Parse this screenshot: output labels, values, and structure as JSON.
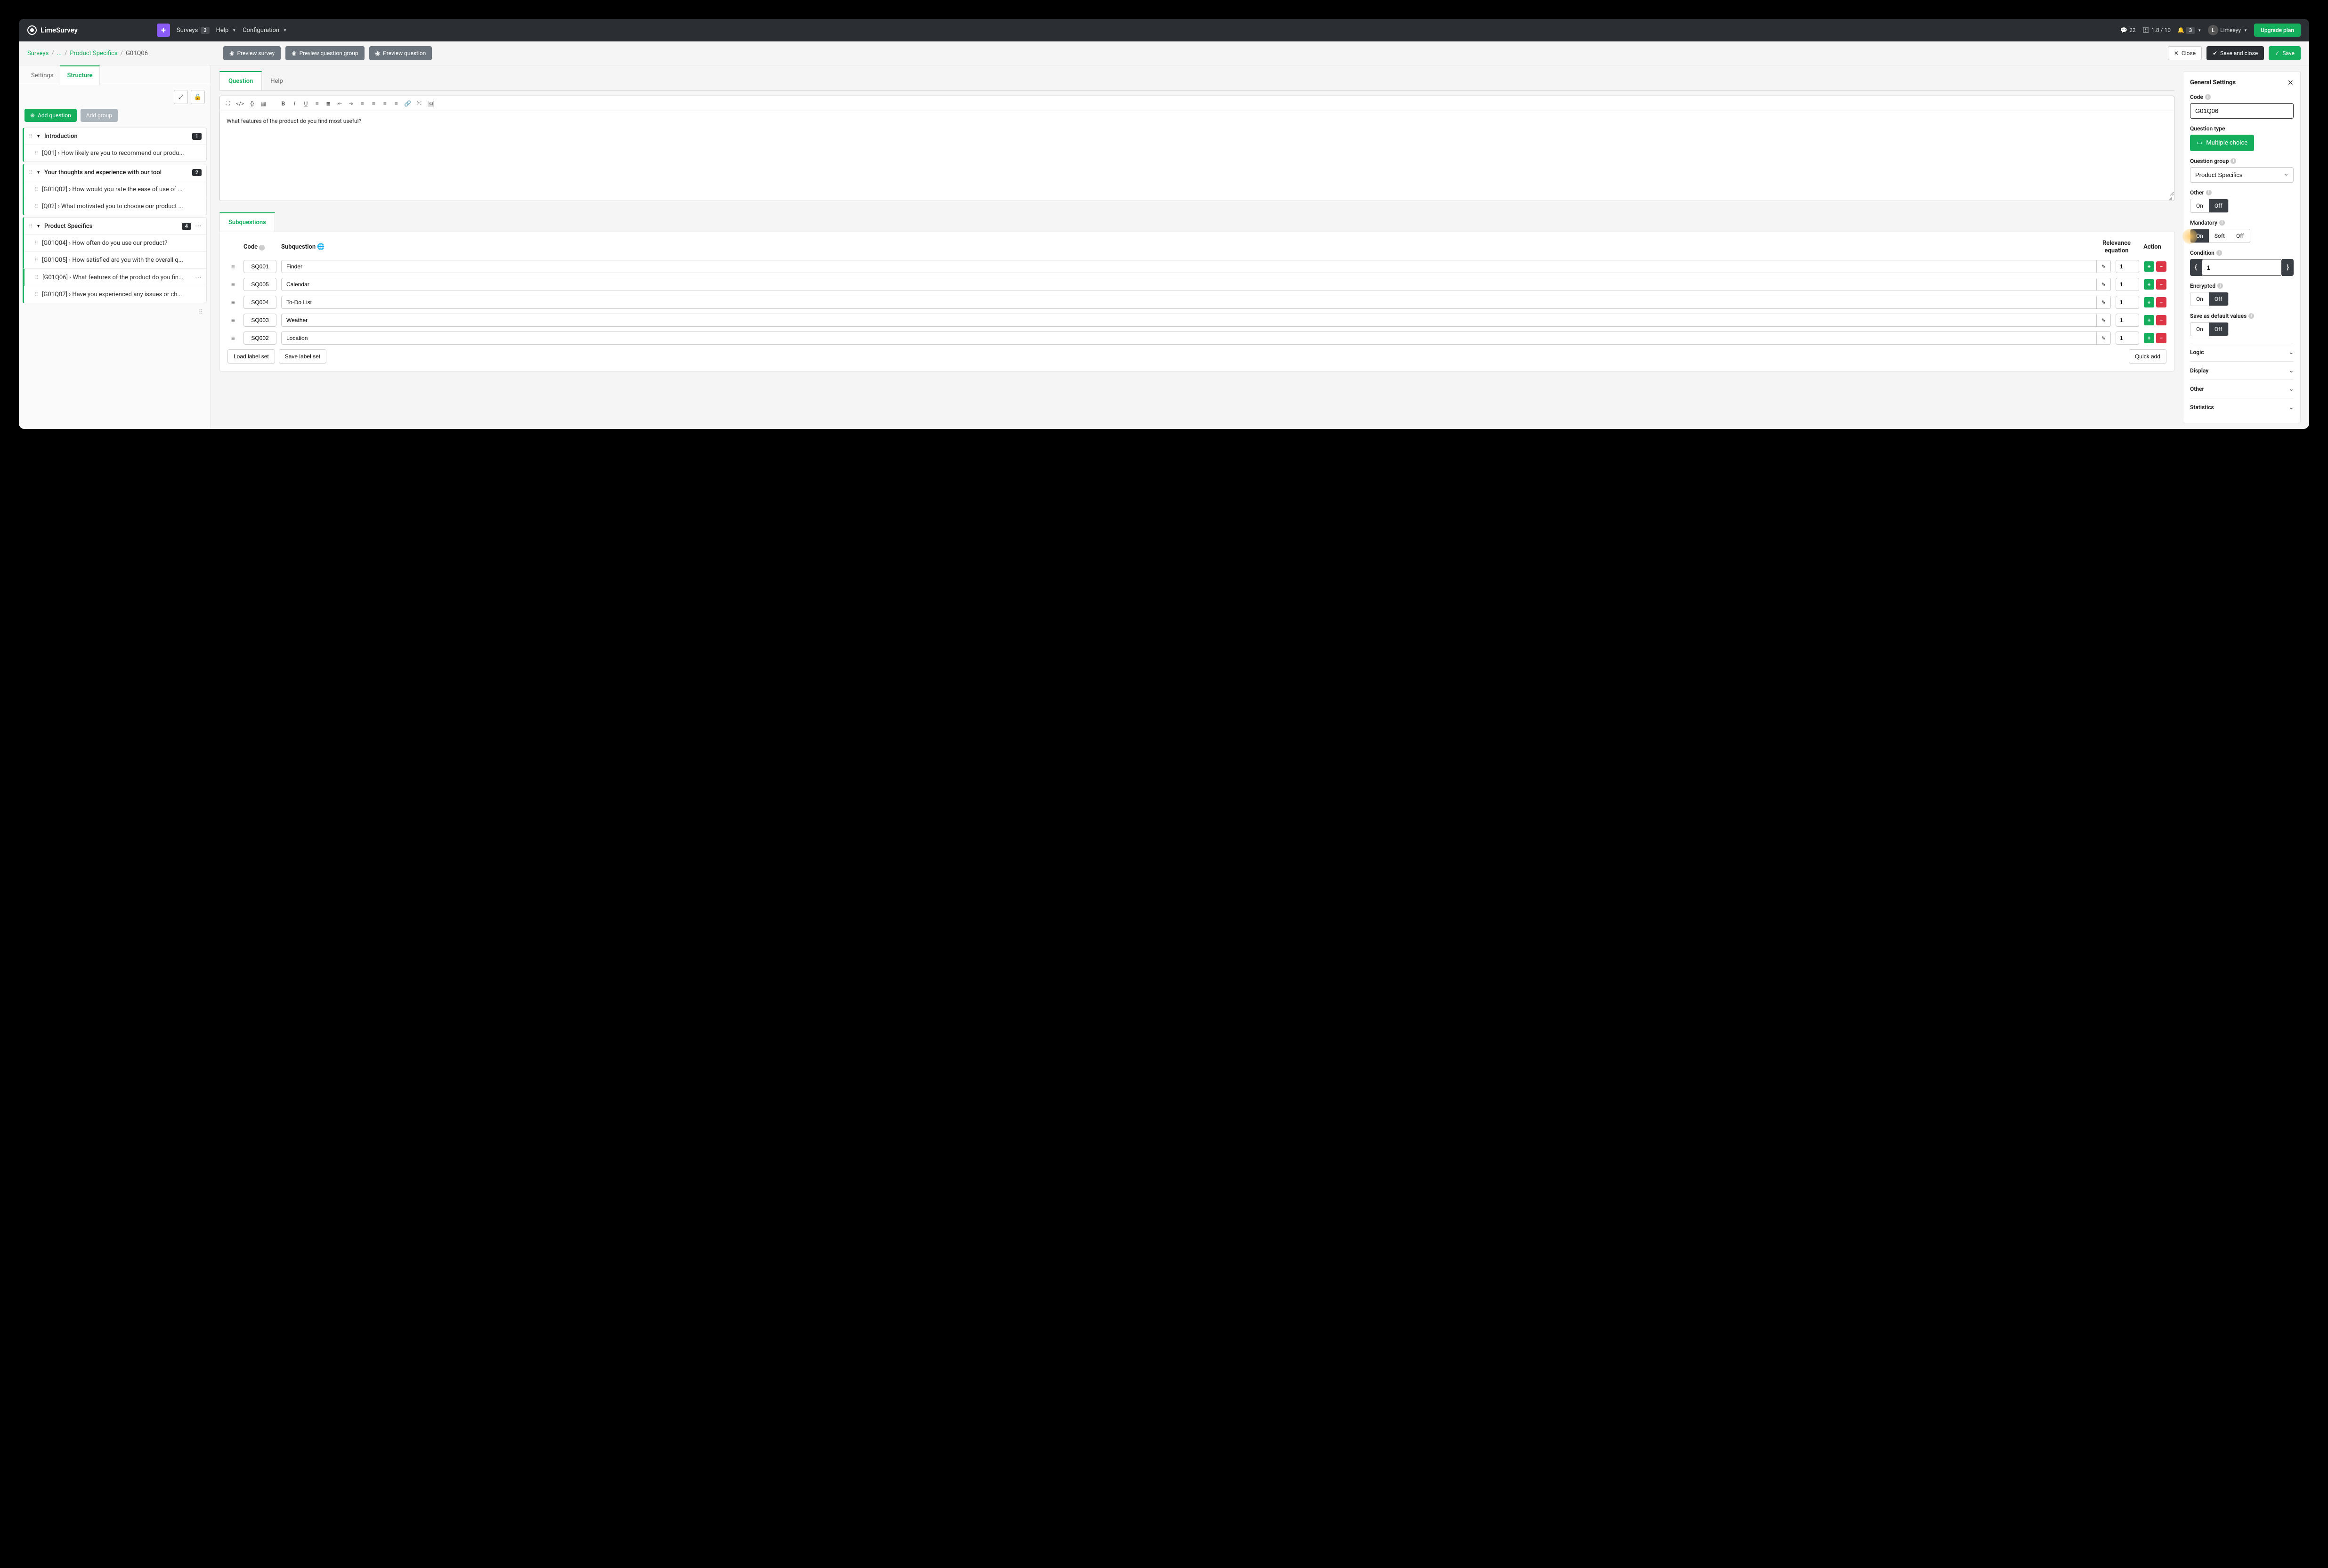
{
  "brand": "LimeSurvey",
  "topnav": {
    "surveys": "Surveys",
    "surveys_count": "3",
    "help": "Help",
    "config": "Configuration",
    "stat1": "22",
    "stat2": "1.8 / 10",
    "stat3": "3",
    "username": "Limeeyy",
    "avatar_initial": "L",
    "upgrade": "Upgrade plan"
  },
  "breadcrumb": {
    "l1": "Surveys",
    "dots": "...",
    "l3": "Product Specifics",
    "cur": "G01Q06"
  },
  "actions": {
    "preview_survey": "Preview survey",
    "preview_group": "Preview question group",
    "preview_question": "Preview question",
    "close": "Close",
    "save_close": "Save and close",
    "save": "Save"
  },
  "sidebar": {
    "tab_settings": "Settings",
    "tab_structure": "Structure",
    "add_question": "Add question",
    "add_group": "Add group",
    "groups": [
      {
        "title": "Introduction",
        "badge": "1",
        "items": [
          {
            "text": "[Q01] › How likely are you to recommend our produ..."
          }
        ]
      },
      {
        "title": "Your thoughts and experience with our tool",
        "badge": "2",
        "items": [
          {
            "text": "[G01Q02] › How would you rate the ease of use of ..."
          },
          {
            "text": "[Q02] › What motivated you to choose our product ..."
          }
        ]
      },
      {
        "title": "Product Specifics",
        "badge": "4",
        "items": [
          {
            "text": "[G01Q04] › How often do you use our product?"
          },
          {
            "text": "[G01Q05] › How satisfied are you with the overall q..."
          },
          {
            "text": "[G01Q06] › What features of the product do you fin...",
            "active": true,
            "dots": true
          },
          {
            "text": "[G01Q07] › Have you experienced any issues or ch..."
          }
        ]
      }
    ]
  },
  "editor": {
    "tab_question": "Question",
    "tab_help": "Help",
    "content": "What features of the product do you find most useful?"
  },
  "subq": {
    "tab": "Subquestions",
    "col_code": "Code",
    "col_sub": "Subquestion",
    "col_rel1": "Relevance",
    "col_rel2": "equation",
    "col_action": "Action",
    "rows": [
      {
        "code": "SQ001",
        "text": "Finder",
        "rel": "1"
      },
      {
        "code": "SQ005",
        "text": "Calendar",
        "rel": "1"
      },
      {
        "code": "SQ004",
        "text": "To-Do List",
        "rel": "1"
      },
      {
        "code": "SQ003",
        "text": "Weather",
        "rel": "1"
      },
      {
        "code": "SQ002",
        "text": "Location",
        "rel": "1"
      }
    ],
    "load_label": "Load label set",
    "save_label": "Save label set",
    "quick_add": "Quick add"
  },
  "settings": {
    "title": "General Settings",
    "code_label": "Code",
    "code_value": "G01Q06",
    "qtype_label": "Question type",
    "qtype_value": "Multiple choice",
    "qgroup_label": "Question group",
    "qgroup_value": "Product Specifics",
    "other_label": "Other",
    "on": "On",
    "off": "Off",
    "soft": "Soft",
    "mandatory_label": "Mandatory",
    "condition_label": "Condition",
    "condition_value": "1",
    "encrypted_label": "Encrypted",
    "savedef_label": "Save as default values",
    "acc_logic": "Logic",
    "acc_display": "Display",
    "acc_other": "Other",
    "acc_stats": "Statistics"
  }
}
